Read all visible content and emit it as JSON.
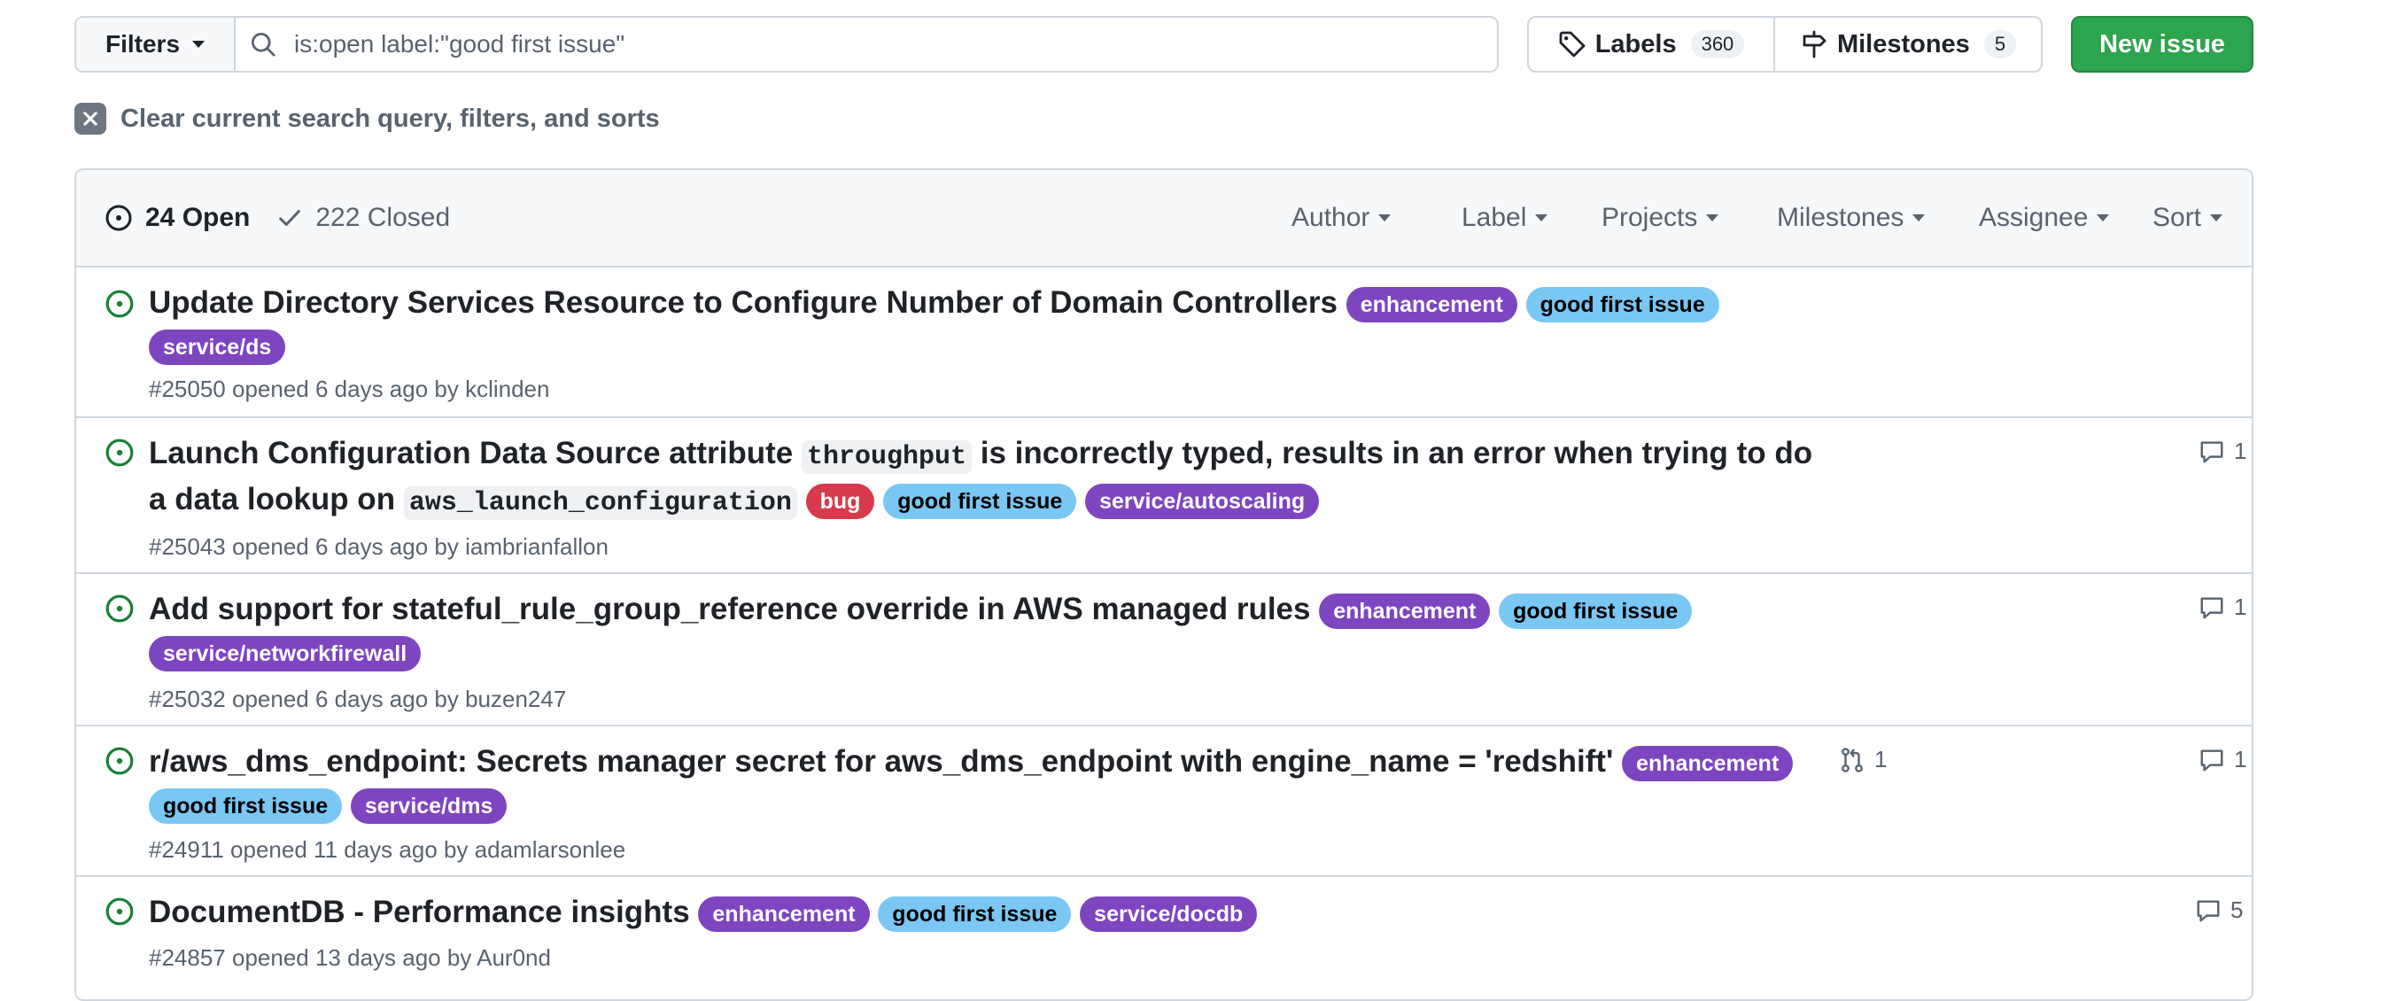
{
  "toolbar": {
    "filters_label": "Filters",
    "search_value": "is:open label:\"good first issue\"",
    "labels_label": "Labels",
    "labels_count": "360",
    "milestones_label": "Milestones",
    "milestones_count": "5",
    "new_issue_label": "New issue"
  },
  "clear_text": "Clear current search query, filters, and sorts",
  "header": {
    "open_label": "24 Open",
    "closed_label": "222 Closed",
    "filters": [
      "Author",
      "Label",
      "Projects",
      "Milestones",
      "Assignee",
      "Sort"
    ]
  },
  "issues": [
    {
      "title": "Update Directory Services Resource to Configure Number of Domain Controllers",
      "labels": [
        "enhancement",
        "good first issue",
        "service/ds"
      ],
      "meta": "#25050 opened 6 days ago by kclinden",
      "comments": ""
    },
    {
      "title_part1": "Launch Configuration Data Source attribute",
      "code1": "throughput",
      "title_part2": "is incorrectly typed, results in an error when trying to do",
      "title_part3": "a data lookup on",
      "code2": "aws_launch_configuration",
      "labels": [
        "bug",
        "good first issue",
        "service/autoscaling"
      ],
      "meta": "#25043 opened 6 days ago by iambrianfallon",
      "comments": "1"
    },
    {
      "title": "Add support for stateful_rule_group_reference override in AWS managed rules",
      "labels": [
        "enhancement",
        "good first issue",
        "service/networkfirewall"
      ],
      "meta": "#25032 opened 6 days ago by buzen247",
      "comments": "1"
    },
    {
      "title": "r/aws_dms_endpoint: Secrets manager secret for aws_dms_endpoint with engine_name = 'redshift'",
      "labels": [
        "enhancement",
        "good first issue",
        "service/dms"
      ],
      "meta": "#24911 opened 11 days ago by adamlarsonlee",
      "pull_requests": "1",
      "comments": "1"
    },
    {
      "title": "DocumentDB - Performance insights",
      "labels": [
        "enhancement",
        "good first issue",
        "service/docdb"
      ],
      "meta": "#24857 opened 13 days ago by Aur0nd",
      "comments": "5"
    }
  ],
  "colors": {
    "open_green": "#1a7f37",
    "label_purple": "#7e45c0",
    "label_blue": "#7ac7f4",
    "label_red": "#d73a4a",
    "button_green": "#2da44e"
  },
  "icons": [
    "chevron-down-icon",
    "search-icon",
    "tag-icon",
    "milestone-icon",
    "close-icon",
    "issue-opened-icon",
    "check-icon",
    "comment-icon",
    "pull-request-icon"
  ]
}
